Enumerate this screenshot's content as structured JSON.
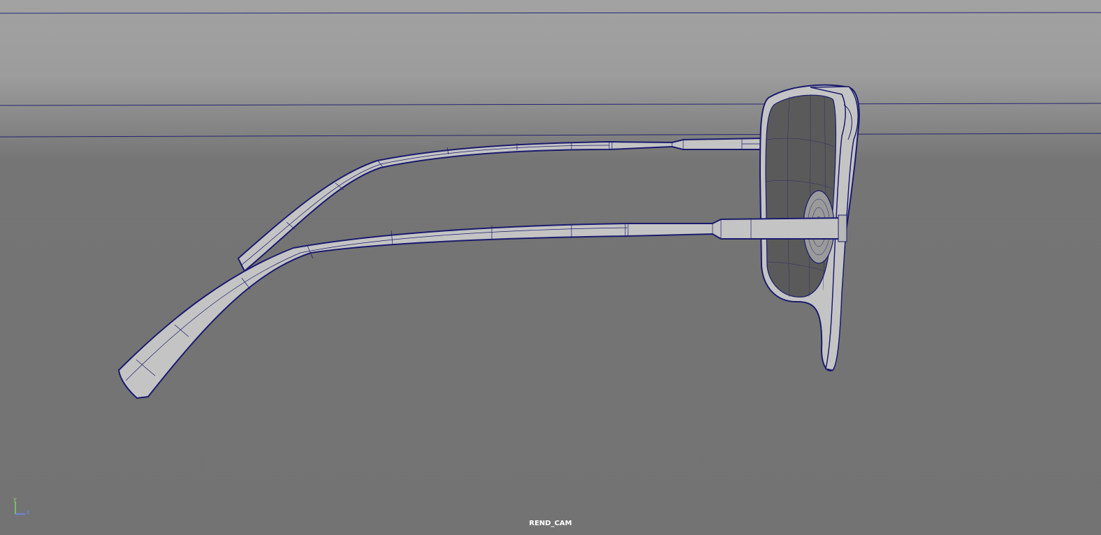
{
  "viewport": {
    "camera_name": "REND_CAM",
    "background_top_color": "#a2a2a2",
    "background_bottom_color": "#737373",
    "wireframe_color": "#1a1a6e",
    "mesh_fill_color": "#c2c2c2",
    "lens_color": "#5a5a5a"
  },
  "axis_gizmo": {
    "y_label": "y",
    "z_label": "z",
    "y_color": "#7bd66a",
    "z_color": "#6a8cff"
  },
  "scene_objects": [
    {
      "name": "sunglasses",
      "parts": [
        "temple-arm-far",
        "temple-arm-near",
        "lens-frame",
        "lens",
        "nose-pad",
        "hinge"
      ]
    }
  ]
}
